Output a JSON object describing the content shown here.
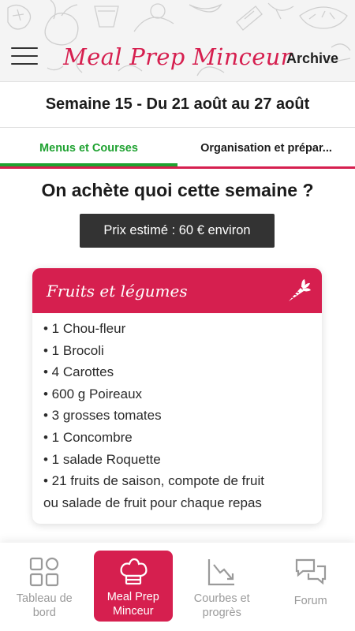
{
  "header": {
    "title": "Meal Prep Minceur",
    "archive_label": "Archive",
    "menu_icon": "hamburger-menu-icon"
  },
  "week": {
    "title": "Semaine 15 - Du 21 août au 27 août"
  },
  "tabs": [
    {
      "label": "Menus et Courses",
      "active": true
    },
    {
      "label": "Organisation et prépar...",
      "active": false
    }
  ],
  "main": {
    "question": "On achète quoi cette semaine ?",
    "price": "Prix estimé : 60 € environ"
  },
  "card": {
    "title": "Fruits et légumes",
    "icon": "carrot-icon",
    "items": [
      "• 1 Chou-fleur",
      "• 1 Brocoli",
      "• 4 Carottes",
      "• 600 g Poireaux",
      "• 3 grosses tomates",
      "• 1 Concombre",
      "• 1 salade Roquette",
      "• 21 fruits de saison, compote de fruit",
      "ou salade de fruit pour chaque repas"
    ]
  },
  "bottom_nav": [
    {
      "label_1": "Tableau de",
      "label_2": "bord",
      "icon": "dashboard-grid-icon",
      "active": false
    },
    {
      "label_1": "Meal Prep",
      "label_2": "Minceur",
      "icon": "chef-hat-icon",
      "active": true
    },
    {
      "label_1": "Courbes et",
      "label_2": "progrès",
      "icon": "trend-chart-icon",
      "active": false
    },
    {
      "label_1": "Forum",
      "label_2": "",
      "icon": "chat-bubbles-icon",
      "active": false
    }
  ],
  "colors": {
    "brand_red": "#d61f4f",
    "active_green": "#1fa231",
    "badge_dark": "#333333",
    "nav_gray": "#9a9a9a"
  }
}
